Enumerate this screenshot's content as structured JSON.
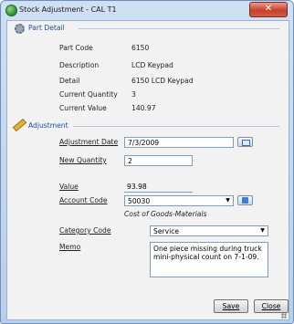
{
  "window": {
    "title": "Stock Adjustment - CAL T1",
    "close_glyph": "✕"
  },
  "part_detail": {
    "heading": "Part Detail",
    "rows": [
      {
        "label": "Part Code",
        "value": "6150"
      },
      {
        "label": "Description",
        "value": "LCD Keypad"
      },
      {
        "label": "Detail",
        "value": "6150 LCD Keypad"
      },
      {
        "label": "Current Quantity",
        "value": "3"
      },
      {
        "label": "Current Value",
        "value": "140.97"
      }
    ]
  },
  "adjustment": {
    "heading": "Adjustment",
    "date_label": "Adjustment Date",
    "date_value": "7/3/2009",
    "new_qty_label": "New Quantity",
    "new_qty_value": "2",
    "value_label": "Value",
    "value_value": "93.98",
    "account_label": "Account Code",
    "account_value": "50030",
    "account_desc": "Cost of Goods-Materials",
    "category_label": "Category Code",
    "category_value": "Service",
    "memo_label": "Memo",
    "memo_value": "One piece missing during truck mini-physical count on 7-1-09."
  },
  "buttons": {
    "save": "Save",
    "close": "Close"
  },
  "icons": {
    "dropdown_arrow": "▼"
  }
}
